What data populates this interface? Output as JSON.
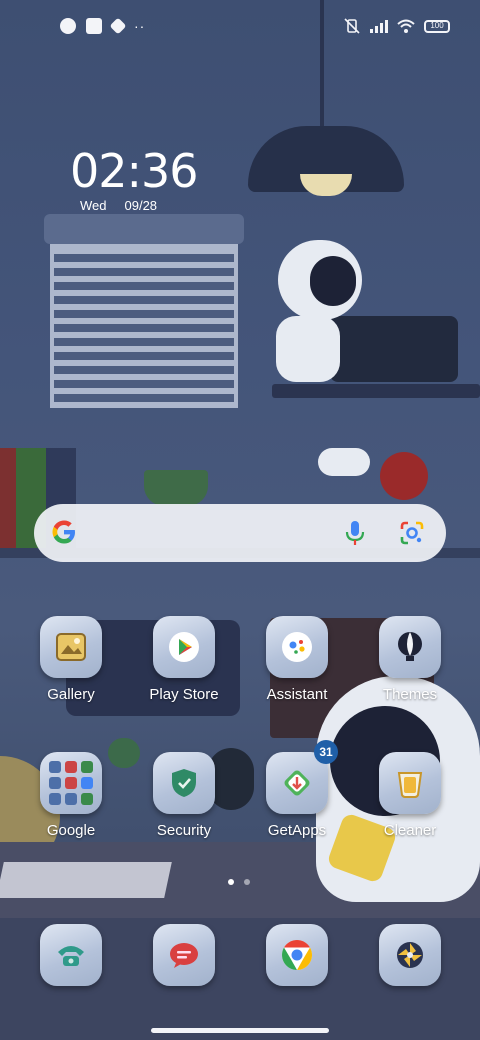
{
  "status_bar": {
    "left_icons": [
      "notification-app-icon-1",
      "notification-app-icon-2",
      "notification-app-icon-3"
    ],
    "more_indicator": "··",
    "battery_level": "100"
  },
  "clock": {
    "time": "02:36",
    "day": "Wed",
    "date": "09/28"
  },
  "search_bar": {
    "icons": [
      "google-g-icon",
      "microphone-icon",
      "google-lens-icon"
    ]
  },
  "apps_row1": [
    {
      "label": "Gallery"
    },
    {
      "label": "Play Store"
    },
    {
      "label": "Assistant"
    },
    {
      "label": "Themes"
    }
  ],
  "apps_row2": [
    {
      "label": "Google"
    },
    {
      "label": "Security"
    },
    {
      "label": "GetApps",
      "badge": "31"
    },
    {
      "label": "Cleaner"
    }
  ],
  "page_indicator": {
    "pages": 2,
    "current": 1
  },
  "dock": [
    "phone-icon",
    "messages-icon",
    "chrome-icon",
    "camera-icon"
  ],
  "colors": {
    "wallpaper": "#44557a",
    "icon_bg": "#b4c2da",
    "badge": "#1f5fa8"
  }
}
